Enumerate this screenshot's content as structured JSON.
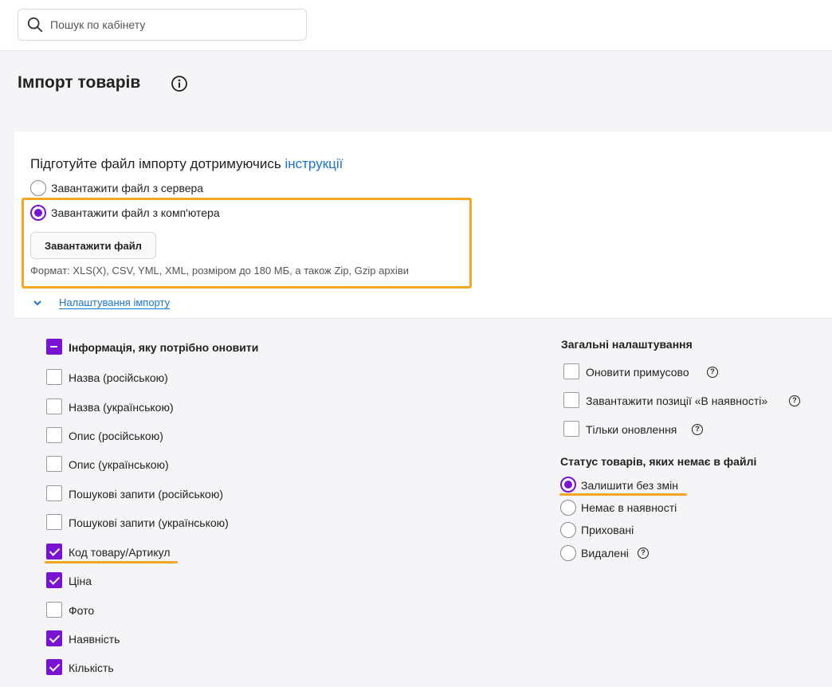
{
  "header": {
    "search_placeholder": "Пошук по кабінету"
  },
  "page": {
    "title": "Імпорт товарів"
  },
  "import_card": {
    "subtitle_text": "Підготуйте файл імпорту дотримуючись ",
    "subtitle_link": "інструкції",
    "source_options": [
      {
        "label": "Завантажити файл з сервера",
        "selected": false
      },
      {
        "label": "Завантажити файл з комп'ютера",
        "selected": true
      }
    ],
    "upload_button": "Завантажити файл",
    "format_note": "Формат: XLS(X), CSV, YML, XML, розміром до 180 МБ, а також Zip, Gzip архіви",
    "settings_link": "Налаштування імпорту"
  },
  "update_info": {
    "heading": "Інформація, яку потрібно оновити",
    "heading_state": "partial",
    "fields": [
      {
        "label": "Назва (російською)",
        "checked": false
      },
      {
        "label": "Назва (українською)",
        "checked": false
      },
      {
        "label": "Опис (російською)",
        "checked": false
      },
      {
        "label": "Опис (українською)",
        "checked": false
      },
      {
        "label": "Пошукові запити (російською)",
        "checked": false
      },
      {
        "label": "Пошукові запити (українською)",
        "checked": false
      },
      {
        "label": "Код товару/Артикул",
        "checked": true
      },
      {
        "label": "Ціна",
        "checked": true
      },
      {
        "label": "Фото",
        "checked": false
      },
      {
        "label": "Наявність",
        "checked": true
      },
      {
        "label": "Кількість",
        "checked": true
      }
    ]
  },
  "general_settings": {
    "heading": "Загальні налаштування",
    "options": [
      {
        "label": "Оновити примусово",
        "checked": false,
        "help": "?"
      },
      {
        "label": "Завантажити позиції «В наявності»",
        "checked": false,
        "help": "?"
      },
      {
        "label": "Тільки оновлення",
        "checked": false,
        "help": "?"
      }
    ]
  },
  "missing_status": {
    "heading": "Статус товарів, яких немає в файлі",
    "options": [
      {
        "label": "Залишити без змін",
        "selected": true
      },
      {
        "label": "Немає в наявності",
        "selected": false
      },
      {
        "label": "Приховані",
        "selected": false
      },
      {
        "label": "Видалені",
        "selected": false,
        "help": "?"
      }
    ]
  },
  "colors": {
    "accent": "#7a12d4",
    "link": "#1a73d9",
    "highlight": "#f5a623"
  }
}
